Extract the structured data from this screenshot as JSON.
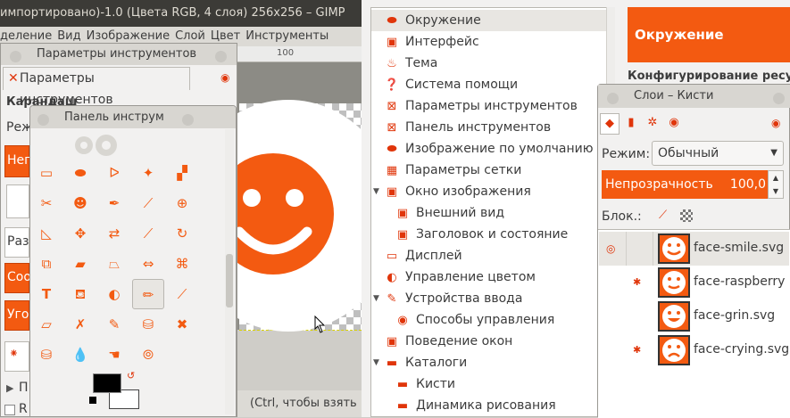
{
  "gimp": {
    "title": "импортировано)-1.0 (Цвета RGB, 4 слоя) 256x256 – GIMP",
    "menu": [
      "деление",
      "Вид",
      "Изображение",
      "Слой",
      "Цвет",
      "Инструменты"
    ],
    "ruler_label": "100",
    "status": "(Ctrl, чтобы взять"
  },
  "tool_options": {
    "title": "Параметры инструментов",
    "tab_label": "Параметры инструментов",
    "tool_name": "Карандаш",
    "mode_prefix": "Реж",
    "opacity_prefix": "Непр",
    "size_prefix": "Раз",
    "ratio_prefix": "Соо",
    "angle_prefix": "Угол",
    "expander1": "П",
    "expander2": "R"
  },
  "toolbox": {
    "title": "Панель инструм",
    "tools": [
      "rect-select",
      "ellipse-select",
      "free-select",
      "fuzzy-select",
      "select-by-color",
      "scissors",
      "foreground-select",
      "paths",
      "color-picker",
      "zoom",
      "measure",
      "move",
      "align",
      "crop",
      "rotate",
      "scale",
      "shear",
      "perspective",
      "flip",
      "cage",
      "text",
      "bucket-fill",
      "blend",
      "pencil",
      "paintbrush",
      "eraser",
      "airbrush",
      "ink",
      "clone",
      "heal",
      "perspective-clone",
      "blur",
      "smudge",
      "dodge-burn"
    ],
    "fg_color": "#000000",
    "bg_color": "#ffffff"
  },
  "preferences": {
    "items": [
      {
        "label": "Окружение",
        "indent": false,
        "expander": "",
        "icon": "environment-icon",
        "selected": true
      },
      {
        "label": "Интерфейс",
        "indent": false,
        "expander": "",
        "icon": "interface-icon",
        "selected": false
      },
      {
        "label": "Тема",
        "indent": false,
        "expander": "",
        "icon": "theme-icon",
        "selected": false
      },
      {
        "label": "Система помощи",
        "indent": false,
        "expander": "",
        "icon": "help-icon",
        "selected": false
      },
      {
        "label": "Параметры инструментов",
        "indent": false,
        "expander": "",
        "icon": "tool-options-icon",
        "selected": false
      },
      {
        "label": "Панель инструментов",
        "indent": false,
        "expander": "",
        "icon": "toolbox-icon",
        "selected": false
      },
      {
        "label": "Изображение по умолчанию",
        "indent": false,
        "expander": "",
        "icon": "default-image-icon",
        "selected": false
      },
      {
        "label": "Параметры сетки",
        "indent": false,
        "expander": "",
        "icon": "grid-icon",
        "selected": false
      },
      {
        "label": "Окно изображения",
        "indent": false,
        "expander": "▼",
        "icon": "image-window-icon",
        "selected": false
      },
      {
        "label": "Внешний вид",
        "indent": true,
        "expander": "",
        "icon": "appearance-icon",
        "selected": false
      },
      {
        "label": "Заголовок и состояние",
        "indent": true,
        "expander": "",
        "icon": "title-status-icon",
        "selected": false
      },
      {
        "label": "Дисплей",
        "indent": false,
        "expander": "",
        "icon": "display-icon",
        "selected": false
      },
      {
        "label": "Управление цветом",
        "indent": false,
        "expander": "",
        "icon": "color-management-icon",
        "selected": false
      },
      {
        "label": "Устройства ввода",
        "indent": false,
        "expander": "▼",
        "icon": "input-devices-icon",
        "selected": false
      },
      {
        "label": "Способы управления",
        "indent": true,
        "expander": "",
        "icon": "input-controllers-icon",
        "selected": false
      },
      {
        "label": "Поведение окон",
        "indent": false,
        "expander": "",
        "icon": "window-management-icon",
        "selected": false
      },
      {
        "label": "Каталоги",
        "indent": false,
        "expander": "▼",
        "icon": "folders-icon",
        "selected": false
      },
      {
        "label": "Кисти",
        "indent": true,
        "expander": "",
        "icon": "brushes-folder-icon",
        "selected": false
      },
      {
        "label": "Динамика рисования",
        "indent": true,
        "expander": "",
        "icon": "dynamics-folder-icon",
        "selected": false
      }
    ],
    "header": "Окружение",
    "subheader": "Конфигурирование ресурсов"
  },
  "layers": {
    "title": "Слои – Кисти",
    "mode_label": "Режим:",
    "mode_value": "Обычный",
    "opacity_label": "Непрозрачность",
    "opacity_value": "100,0",
    "lock_label": "Блок.:",
    "rows": [
      {
        "name": "face-smile.svg",
        "face": "smile"
      },
      {
        "name": "face-raspberry",
        "face": "raspberry"
      },
      {
        "name": "face-grin.svg",
        "face": "grin"
      },
      {
        "name": "face-crying.svg",
        "face": "crying"
      }
    ]
  },
  "accent_color": "#f35a11"
}
